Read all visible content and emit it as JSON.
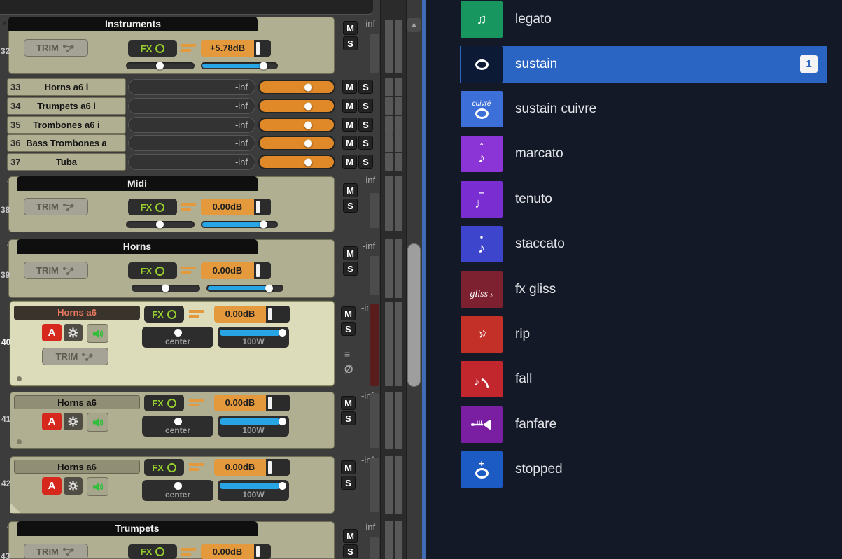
{
  "window": {
    "scroll_up_arrow": "▲"
  },
  "colors": {
    "panel_tan": "#b1af92",
    "panel_selected": "#dddcba",
    "value_orange": "#e49a3c",
    "fader_blue": "#27a5e5",
    "fx_green": "#97d02e",
    "record_red": "#d6281c",
    "divider_blue": "#3e6cb5",
    "selection_blue": "#2b65c3",
    "right_panel_bg": "#141928"
  },
  "tcp": {
    "labels": {
      "mute": "M",
      "solo": "S",
      "trim": "TRIM",
      "fx": "FX",
      "meter_readout": "-inf",
      "phase": "Ø",
      "sends": "≡",
      "collapse_arrow": "▼"
    },
    "headers": {
      "instruments": "Instruments",
      "midi": "Midi",
      "horns": "Horns",
      "trumpets": "Trumpets"
    },
    "bus_tracks": [
      {
        "num": "32",
        "db": "+5.78dB"
      },
      {
        "num": "38",
        "db": "0.00dB"
      },
      {
        "num": "39",
        "db": "0.00dB"
      },
      {
        "num": "43",
        "db": "0.00dB"
      }
    ],
    "compact_tracks": [
      {
        "num": "33",
        "name": "Horns a6 i",
        "readout": "-inf"
      },
      {
        "num": "34",
        "name": "Trumpets a6 i",
        "readout": "-inf"
      },
      {
        "num": "35",
        "name": "Trombones a6 i",
        "readout": "-inf"
      },
      {
        "num": "36",
        "name": "Bass Trombones a",
        "readout": "-inf"
      },
      {
        "num": "37",
        "name": "Tuba",
        "readout": "-inf"
      }
    ],
    "horn_tracks": [
      {
        "num": "40",
        "name": "Horns a6",
        "arm": "A",
        "db": "0.00dB",
        "pan": "center",
        "width": "100W",
        "selected": true
      },
      {
        "num": "41",
        "name": "Horns a6",
        "arm": "A",
        "db": "0.00dB",
        "pan": "center",
        "width": "100W",
        "selected": false
      },
      {
        "num": "42",
        "name": "Horns a6",
        "arm": "A",
        "db": "0.00dB",
        "pan": "center",
        "width": "100W",
        "selected": false
      }
    ]
  },
  "articulations": {
    "selected_index": 1,
    "items": [
      {
        "label": "legato",
        "icon_color": "#17975f",
        "glyph": "♫"
      },
      {
        "label": "sustain",
        "icon_color": "#0c1a36",
        "selected": true,
        "badge": "1"
      },
      {
        "label": "sustain cuivre",
        "icon_color": "#3c6fd8",
        "caption": "cuivré"
      },
      {
        "label": "marcato",
        "icon_color": "#8c35d6",
        "glyph": "♪",
        "mark": "ˆ"
      },
      {
        "label": "tenuto",
        "icon_color": "#7a2ed2",
        "glyph": "♩",
        "mark": "–"
      },
      {
        "label": "staccato",
        "icon_color": "#3d45cc",
        "glyph": "♪",
        "mark": "•"
      },
      {
        "label": "fx gliss",
        "icon_color": "#7d2030",
        "caption": "gliss",
        "glyph": "♪"
      },
      {
        "label": "rip",
        "icon_color": "#c23028",
        "glyph": "♪♪"
      },
      {
        "label": "fall",
        "icon_color": "#c2272d",
        "glyph": "♪"
      },
      {
        "label": "fanfare",
        "icon_color": "#7b1fa2"
      },
      {
        "label": "stopped",
        "icon_color": "#1d5bc4",
        "mark": "+"
      }
    ]
  }
}
